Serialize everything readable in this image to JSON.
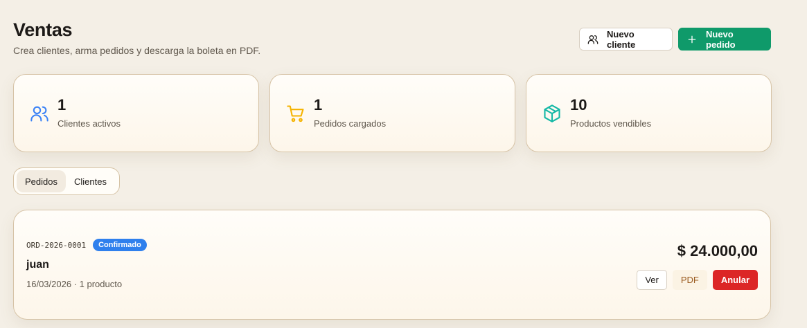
{
  "header": {
    "title": "Ventas",
    "subtitle": "Crea clientes, arma pedidos y descarga la boleta en PDF."
  },
  "actions": {
    "new_client": {
      "label": "Nuevo cliente",
      "icon": "users-icon"
    },
    "new_order": {
      "label": "Nuevo pedido",
      "icon": "plus-icon"
    }
  },
  "stats": [
    {
      "value": "1",
      "label": "Clientes activos",
      "icon": "users-icon",
      "color": "#3b82f6"
    },
    {
      "value": "1",
      "label": "Pedidos cargados",
      "icon": "cart-icon",
      "color": "#f5b300"
    },
    {
      "value": "10",
      "label": "Productos vendibles",
      "icon": "box-icon",
      "color": "#14b8a6"
    }
  ],
  "tabs": [
    {
      "label": "Pedidos",
      "active": true
    },
    {
      "label": "Clientes",
      "active": false
    }
  ],
  "order": {
    "code": "ORD-2026-0001",
    "status": "Confirmado",
    "customer": "juan",
    "meta": "16/03/2026 · 1 producto",
    "total": "$ 24.000,00",
    "buttons": {
      "view": "Ver",
      "pdf": "PDF",
      "cancel": "Anular"
    }
  },
  "colors": {
    "background": "#f4efe6",
    "primary": "#0f9a6a",
    "badge": "#2f80ed",
    "danger": "#dc2626"
  }
}
